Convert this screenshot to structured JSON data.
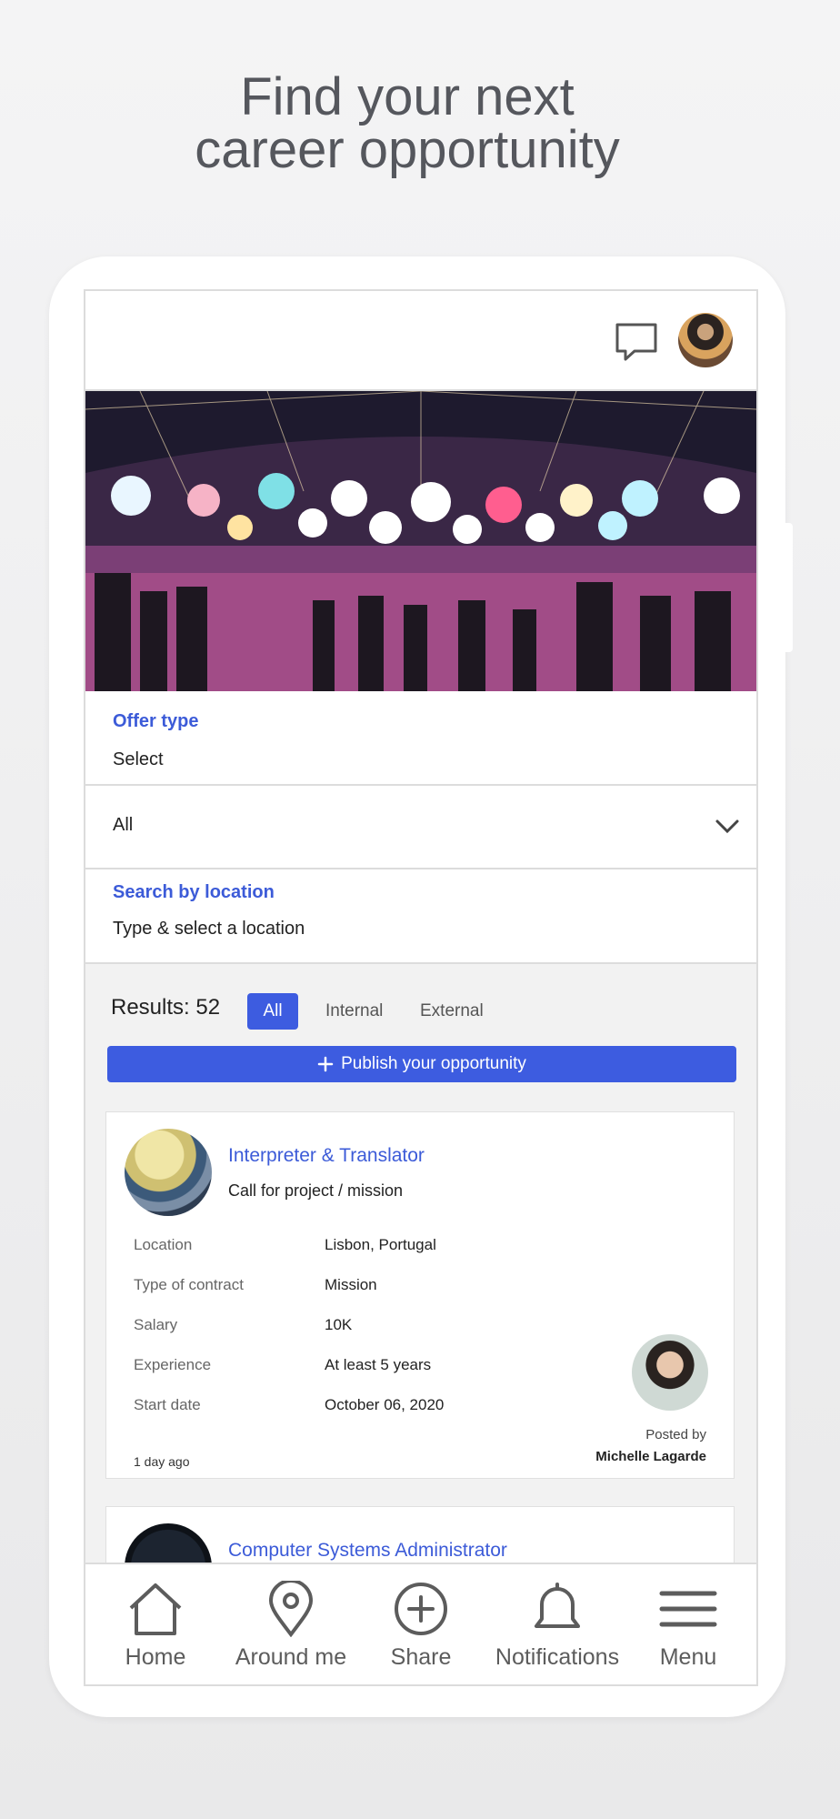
{
  "hero": {
    "line1": "Find your next",
    "line2": "career opportunity"
  },
  "filters": {
    "offer_type_label": "Offer type",
    "offer_type_value": "Select",
    "category_value": "All",
    "location_label": "Search by location",
    "location_placeholder": "Type & select a location"
  },
  "results": {
    "count_text": "Results: 52",
    "tabs": [
      "All",
      "Internal",
      "External"
    ],
    "active_tab": "All"
  },
  "publish_button": {
    "icon": "plus-icon",
    "label": "Publish your opportunity"
  },
  "cards": [
    {
      "title": "Interpreter & Translator",
      "subtitle": "Call for project / mission",
      "fields": [
        {
          "key": "Location",
          "value": "Lisbon, Portugal"
        },
        {
          "key": "Type of contract",
          "value": "Mission"
        },
        {
          "key": "Salary",
          "value": "10K"
        },
        {
          "key": "Experience",
          "value": "At least 5 years"
        },
        {
          "key": "Start date",
          "value": "October 06, 2020"
        }
      ],
      "posted_by_label": "Posted by",
      "poster_name": "Michelle Lagarde",
      "age": "1 day ago"
    },
    {
      "title": "Computer Systems Administrator"
    }
  ],
  "nav": [
    {
      "label": "Home",
      "icon": "home-icon"
    },
    {
      "label": "Around me",
      "icon": "map-pin-icon"
    },
    {
      "label": "Share",
      "icon": "plus-circle-icon"
    },
    {
      "label": "Notifications",
      "icon": "bell-icon"
    },
    {
      "label": "Menu",
      "icon": "menu-icon"
    }
  ],
  "colors": {
    "accent": "#3d5ce0",
    "link": "#3c5bd8",
    "text_muted": "#55575d"
  }
}
